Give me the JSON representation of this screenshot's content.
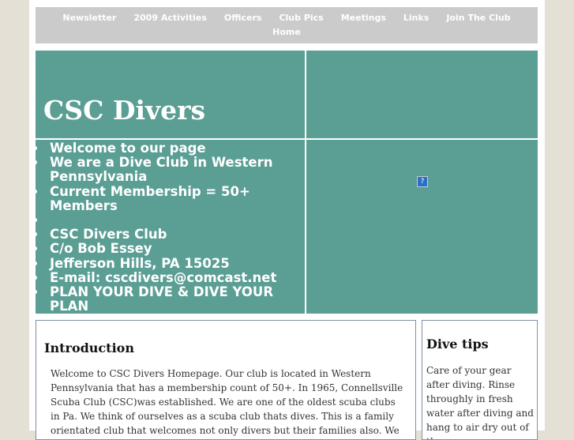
{
  "nav": {
    "items": [
      "Newsletter",
      "2009 Activities",
      "Officers",
      "Club Pics",
      "Meetings",
      "Links",
      "Join The Club",
      "Home"
    ]
  },
  "hero": {
    "title": "CSC Divers",
    "bullets": [
      "Welcome to our page",
      "We are a Dive Club in Western Pennsylvania",
      "Current Membership = 50+ Members",
      "",
      "CSC Divers Club",
      "C/o Bob Essey",
      "Jefferson Hills, PA 15025",
      "E-mail: cscdivers@comcast.net",
      "PLAN YOUR DIVE & DIVE YOUR PLAN"
    ],
    "image_icon": "?"
  },
  "intro": {
    "heading": "Introduction",
    "text": "Welcome to CSC Divers Homepage. Our club is located in Western Pennsylvania that has a membership count of 50+. In 1965, Connellsville Scuba Club (CSC)was established. We are one of the oldest scuba clubs in Pa. We think of ourselves as a scuba club thats dives. This is a family orientated club that welcomes not only divers but their families also. We take pride in"
  },
  "tips": {
    "heading": "Dive tips",
    "text": "Care of your gear after diving. Rinse throughly in fresh water after diving and hang to air dry out of the sun."
  }
}
